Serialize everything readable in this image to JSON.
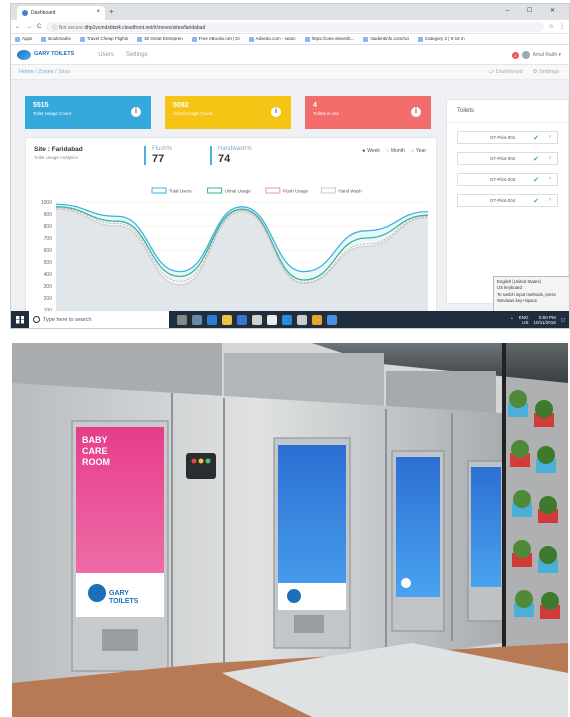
{
  "browser": {
    "tab_title": "Dashboard",
    "new_tab": "+",
    "window_controls": "– ☐ ✕",
    "nav_back": "←",
    "nav_forward": "→",
    "nav_reload": "C",
    "security": "ⓘ Not secure",
    "url": "dhp1vcmdxbtst4.cloudfront.net/#/zones/sites/faridabad",
    "bookmarks": [
      "Apps",
      "Bookmarks",
      "Travel Cheap Flights",
      "30 Great Entrepren",
      "Free eBooks.net | Di",
      "Adsedo.com - searc",
      "https://care.stesesb...",
      "studentinfo.com/sci",
      "Category 2 | 9-16 m"
    ]
  },
  "app": {
    "brand": "GARY TOILETS",
    "nav": [
      "Users",
      "Settings"
    ],
    "notif_count": "1",
    "user_name": "Amal Raith ▾"
  },
  "breadcrumb": {
    "items": [
      "Home",
      "Zones",
      "Sites"
    ],
    "separator": "/",
    "right_links": [
      "⤻ Dashboard",
      "⚙ Settings"
    ]
  },
  "cards": [
    {
      "value": "5515",
      "label": "Toilet Usage Count",
      "color": "#36a9dc"
    },
    {
      "value": "5092",
      "label": "Urinal Usage Count",
      "color": "#f6c414"
    },
    {
      "value": "4",
      "label": "Toilets in use",
      "color": "#f46d6d"
    }
  ],
  "site": {
    "title": "Site : Faridabad",
    "subtitle": "Toilet Usage Analytics",
    "flush_label": "Flush%",
    "flush_value": "77",
    "handwash_label": "Handwash%",
    "handwash_value": "74",
    "periods": [
      "Week",
      "Month",
      "Year"
    ],
    "selected_period": "Week"
  },
  "toilets_panel": {
    "title": "Toilets",
    "items": [
      "GT-Pilot-001",
      "GT-Pilot-002",
      "GT-Pilot-003",
      "GT-Pilot-004"
    ]
  },
  "ime_popup": {
    "line1": "English (United States)",
    "line2": "US keyboard",
    "line3": "To switch input methods, press",
    "line4": "Windows key+Space."
  },
  "taskbar": {
    "search_placeholder": "Type here to search",
    "lang": "ENG",
    "region": "US",
    "time": "5:50 PM",
    "date": "10/11/2018"
  },
  "chart_data": {
    "type": "area",
    "legend": [
      "Total Users",
      "Urinal Usage",
      "Flush Usage",
      "Hand Wash"
    ],
    "series_colors": [
      "#3fb3e0",
      "#36b894",
      "#e79aa3",
      "#c8c8c8"
    ],
    "y_ticks": [
      0,
      100,
      200,
      300,
      400,
      500,
      600,
      700,
      800,
      900,
      1000
    ],
    "ylim": [
      0,
      1000
    ],
    "x": [
      0,
      1,
      2,
      3,
      4,
      5,
      6
    ],
    "series": [
      {
        "name": "Total Users",
        "values": [
          980,
          880,
          420,
          960,
          420,
          760,
          920
        ]
      },
      {
        "name": "Urinal Usage",
        "values": [
          960,
          840,
          380,
          940,
          350,
          700,
          890
        ]
      },
      {
        "name": "Flush Usage",
        "values": [
          950,
          820,
          340,
          930,
          330,
          650,
          880
        ]
      },
      {
        "name": "Hand Wash",
        "values": [
          940,
          800,
          310,
          920,
          320,
          630,
          870
        ]
      }
    ]
  },
  "photo": {
    "door_left_text": "BABY CARE ROOM",
    "door_brand": "GARY TOILETS"
  }
}
